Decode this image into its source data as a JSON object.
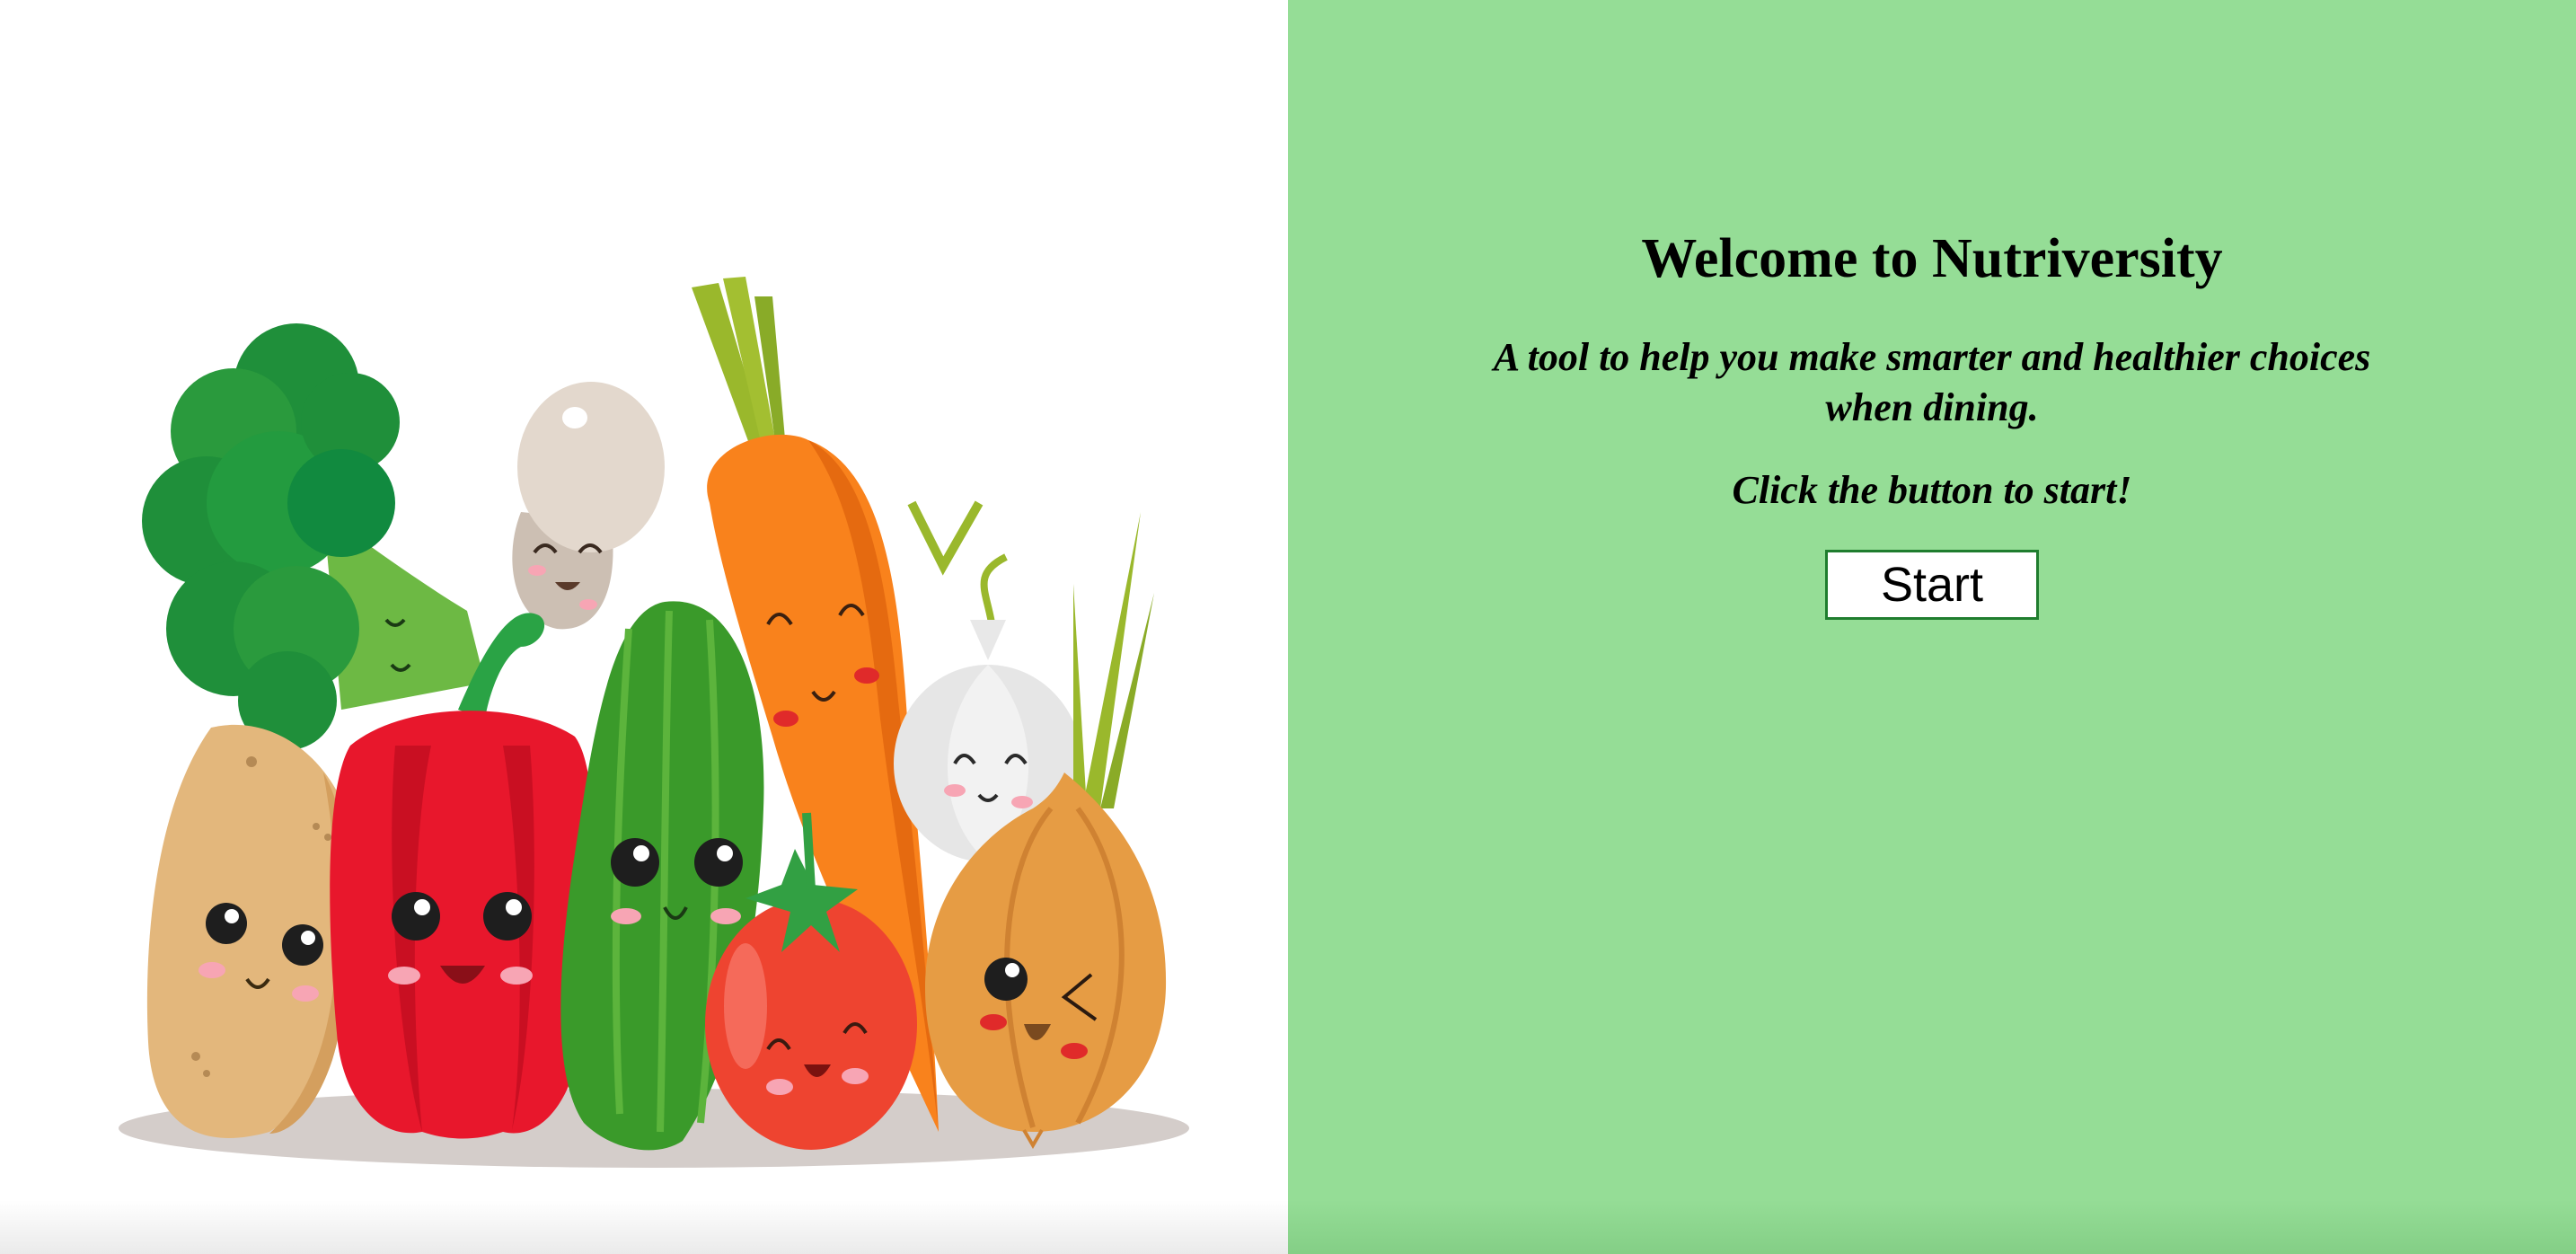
{
  "hero": {
    "image_name": "cartoon-vegetables-illustration",
    "subjects": [
      "broccoli",
      "mushroom",
      "carrot",
      "potato",
      "red-pepper",
      "cucumber",
      "tomato",
      "garlic",
      "onion"
    ]
  },
  "welcome": {
    "title": "Welcome to Nutriversity",
    "tagline": "A tool to help you make smarter and healthier choices when dining.",
    "prompt": "Click the button to start!",
    "start_label": "Start"
  },
  "colors": {
    "panel_background": "#95dd96",
    "button_border": "#1f7d2e",
    "text": "#000000"
  }
}
